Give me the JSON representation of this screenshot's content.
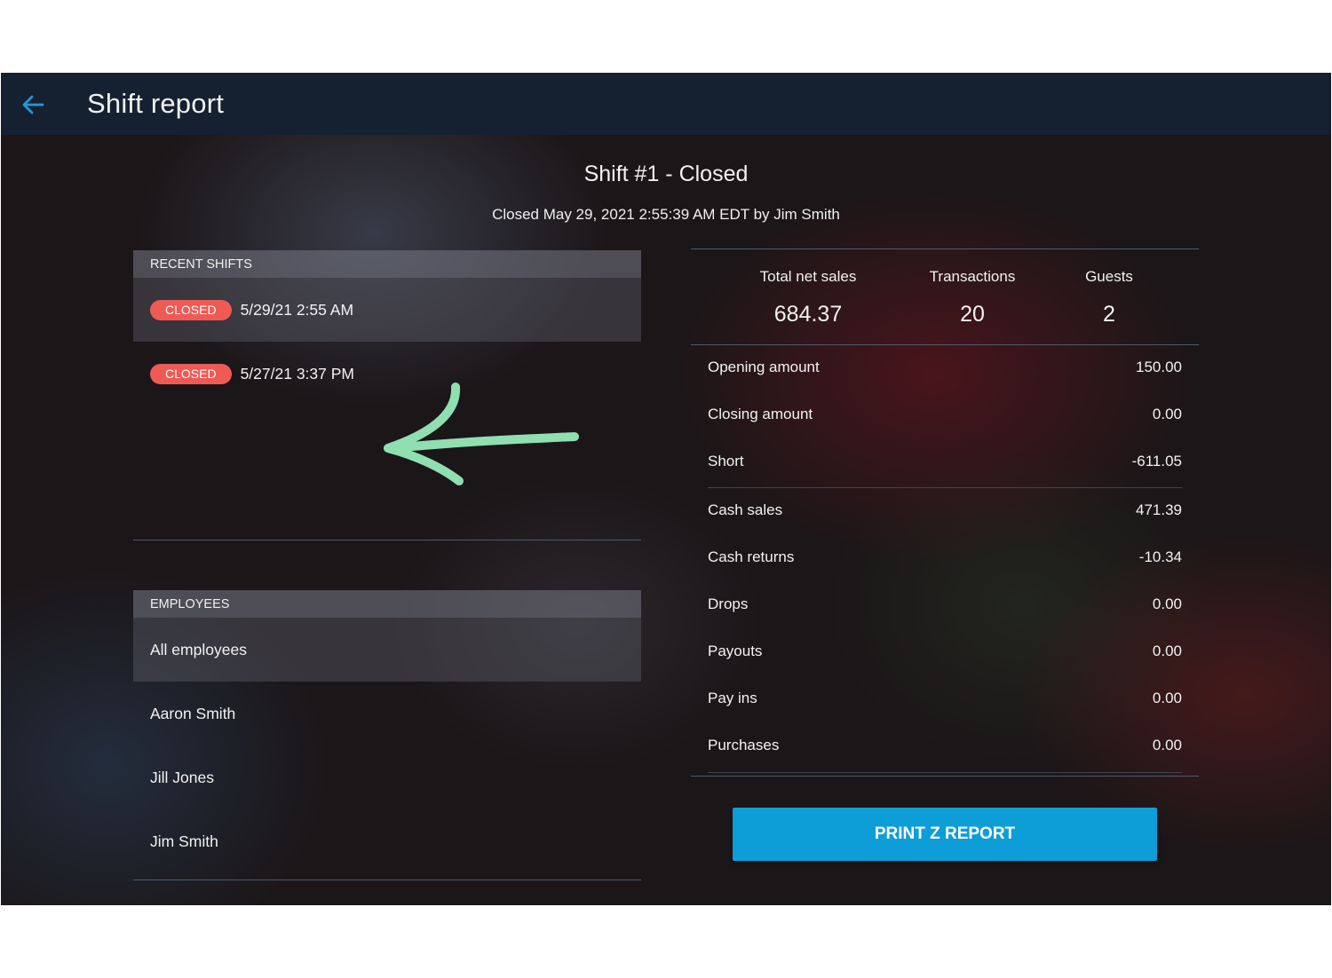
{
  "header": {
    "title": "Shift report",
    "back_icon": "arrow-left-icon",
    "back_color": "#1f9ad6",
    "bar_color": "#152130"
  },
  "shift": {
    "title": "Shift #1 - Closed",
    "subtitle": "Closed May 29, 2021 2:55:39 AM EDT by Jim Smith"
  },
  "recent_shifts": {
    "header": "RECENT SHIFTS",
    "items": [
      {
        "status": "CLOSED",
        "datetime": "5/29/21 2:55 AM",
        "selected": true
      },
      {
        "status": "CLOSED",
        "datetime": "5/27/21 3:37 PM",
        "selected": false
      }
    ]
  },
  "employees": {
    "header": "EMPLOYEES",
    "items": [
      {
        "name": "All employees",
        "selected": true
      },
      {
        "name": "Aaron Smith",
        "selected": false
      },
      {
        "name": "Jill Jones",
        "selected": false
      },
      {
        "name": "Jim Smith",
        "selected": false
      }
    ]
  },
  "stats": [
    {
      "label": "Total net sales",
      "value": "684.37"
    },
    {
      "label": "Transactions",
      "value": "20"
    },
    {
      "label": "Guests",
      "value": "2"
    }
  ],
  "summary": [
    {
      "label": "Opening amount",
      "value": "150.00"
    },
    {
      "label": "Closing amount",
      "value": "0.00"
    },
    {
      "label": "Short",
      "value": "-611.05"
    },
    {
      "label": "Cash sales",
      "value": "471.39"
    },
    {
      "label": "Cash returns",
      "value": "-10.34"
    },
    {
      "label": "Drops",
      "value": "0.00"
    },
    {
      "label": "Payouts",
      "value": "0.00"
    },
    {
      "label": "Pay ins",
      "value": "0.00"
    },
    {
      "label": "Purchases",
      "value": "0.00"
    }
  ],
  "print_button": {
    "label": "PRINT Z REPORT",
    "color": "#0d9dd7"
  },
  "badge_color": "#ef5a55",
  "annotation": {
    "icon": "hand-drawn-arrow-icon",
    "color": "#8fdfb0"
  }
}
